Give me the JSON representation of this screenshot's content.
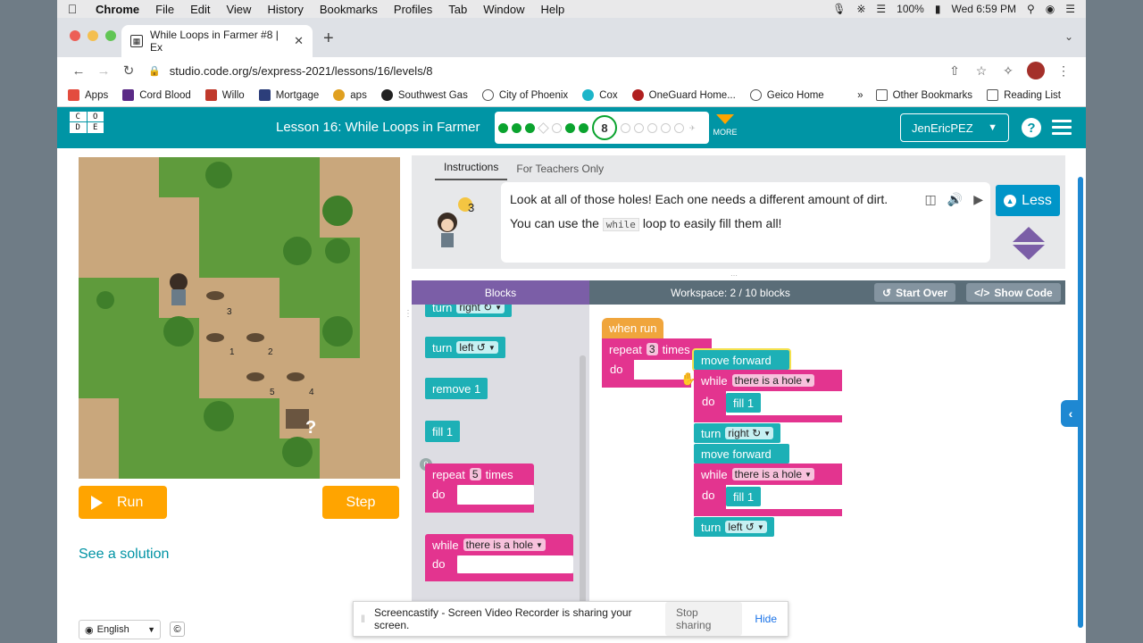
{
  "menubar": {
    "app": "Chrome",
    "items": [
      "File",
      "Edit",
      "View",
      "History",
      "Bookmarks",
      "Profiles",
      "Tab",
      "Window",
      "Help"
    ],
    "battery": "100%",
    "clock": "Wed 6:59 PM"
  },
  "browser": {
    "tab_title": "While Loops in Farmer #8 | Ex",
    "url": "studio.code.org/s/express-2021/lessons/16/levels/8",
    "bookmarks": [
      "Apps",
      "Cord Blood",
      "Willo",
      "Mortgage",
      "aps",
      "Southwest Gas",
      "City of Phoenix",
      "Cox",
      "OneGuard Home...",
      "Geico Home"
    ],
    "other_bookmarks": "Other Bookmarks",
    "reading_list": "Reading List",
    "more": "»"
  },
  "header": {
    "logo_letters": [
      "C",
      "O",
      "D",
      "E"
    ],
    "lesson_title": "Lesson 16: While Loops in Farmer",
    "current_level": "8",
    "more_label": "MORE",
    "user": "JenEricPEZ",
    "help": "?",
    "colors": {
      "teal": "#0095a5",
      "orange": "#ffa400",
      "complete": "#0aa32e"
    }
  },
  "play": {
    "run_label": "Run",
    "step_label": "Step",
    "solution_link": "See a solution",
    "language": "English",
    "copyright": "©",
    "maze_labels": [
      "3",
      "1",
      "2",
      "5",
      "4",
      "?"
    ]
  },
  "instructions": {
    "tabs": [
      "Instructions",
      "For Teachers Only"
    ],
    "line1": "Look at all of those holes! Each one needs a different amount of dirt.",
    "line2_pre": "You can use the",
    "line2_code": "while",
    "line2_post": "loop to easily fill them all!",
    "hint_count": "3",
    "less_label": "Less"
  },
  "workspace": {
    "blocks_tab": "Blocks",
    "title": "Workspace: 2 / 10 blocks",
    "start_over": "Start Over",
    "show_code": "Show Code",
    "toolbox": {
      "turn_right_top": "turn",
      "turn_right_field": "right ↻",
      "turn_left": "turn",
      "turn_left_field": "left ↺",
      "remove": "remove 1",
      "fill": "fill 1",
      "repeat": "repeat",
      "repeat_count": "5",
      "times": "times",
      "do": "do",
      "while": "while",
      "while_cond": "there is a hole",
      "badge": "0"
    },
    "program": {
      "when_run": "when run",
      "repeat": "repeat",
      "repeat_count": "3",
      "times": "times",
      "do": "do",
      "move_forward": "move forward",
      "while": "while",
      "while_cond": "there is a hole",
      "fill": "fill 1",
      "turn": "turn",
      "right": "right ↻",
      "left": "left ↺"
    }
  },
  "screencastify": {
    "message": "Screencastify - Screen Video Recorder is sharing your screen.",
    "stop": "Stop sharing",
    "hide": "Hide"
  }
}
